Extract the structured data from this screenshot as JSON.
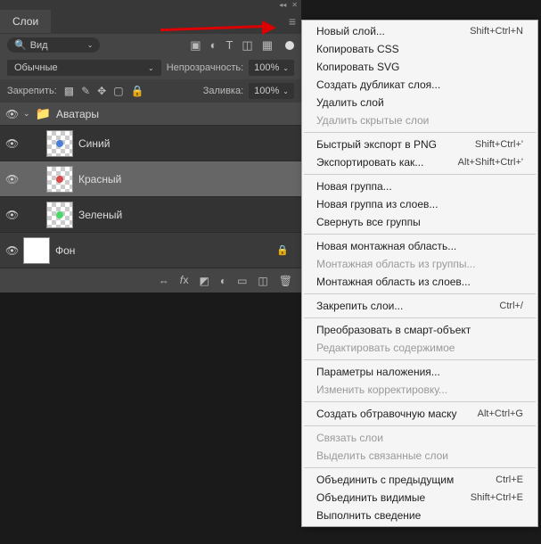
{
  "panel": {
    "tab": "Слои",
    "search": {
      "placeholder": "",
      "value": "Вид"
    },
    "blend_mode": "Обычные",
    "opacity_label": "Непрозрачность:",
    "opacity_value": "100%",
    "lock_label": "Закрепить:",
    "fill_label": "Заливка:",
    "fill_value": "100%"
  },
  "layers": {
    "folder": "Аватары",
    "items": [
      {
        "name": "Синий"
      },
      {
        "name": "Красный"
      },
      {
        "name": "Зеленый"
      },
      {
        "name": "Фон"
      }
    ]
  },
  "menu": {
    "sections": [
      [
        {
          "label": "Новый слой...",
          "shortcut": "Shift+Ctrl+N",
          "disabled": false
        },
        {
          "label": "Копировать CSS",
          "shortcut": "",
          "disabled": false
        },
        {
          "label": "Копировать SVG",
          "shortcut": "",
          "disabled": false
        },
        {
          "label": "Создать дубликат слоя...",
          "shortcut": "",
          "disabled": false
        },
        {
          "label": "Удалить слой",
          "shortcut": "",
          "disabled": false
        },
        {
          "label": "Удалить скрытые слои",
          "shortcut": "",
          "disabled": true
        }
      ],
      [
        {
          "label": "Быстрый экспорт в PNG",
          "shortcut": "Shift+Ctrl+'",
          "disabled": false
        },
        {
          "label": "Экспортировать как...",
          "shortcut": "Alt+Shift+Ctrl+'",
          "disabled": false
        }
      ],
      [
        {
          "label": "Новая группа...",
          "shortcut": "",
          "disabled": false
        },
        {
          "label": "Новая группа из слоев...",
          "shortcut": "",
          "disabled": false
        },
        {
          "label": "Свернуть все группы",
          "shortcut": "",
          "disabled": false
        }
      ],
      [
        {
          "label": "Новая монтажная область...",
          "shortcut": "",
          "disabled": false
        },
        {
          "label": "Монтажная область из группы...",
          "shortcut": "",
          "disabled": true
        },
        {
          "label": "Монтажная область из слоев...",
          "shortcut": "",
          "disabled": false
        }
      ],
      [
        {
          "label": "Закрепить слои...",
          "shortcut": "Ctrl+/",
          "disabled": false
        }
      ],
      [
        {
          "label": "Преобразовать в смарт-объект",
          "shortcut": "",
          "disabled": false
        },
        {
          "label": "Редактировать содержимое",
          "shortcut": "",
          "disabled": true
        }
      ],
      [
        {
          "label": "Параметры наложения...",
          "shortcut": "",
          "disabled": false
        },
        {
          "label": "Изменить корректировку...",
          "shortcut": "",
          "disabled": true
        }
      ],
      [
        {
          "label": "Создать обтравочную маску",
          "shortcut": "Alt+Ctrl+G",
          "disabled": false
        }
      ],
      [
        {
          "label": "Связать слои",
          "shortcut": "",
          "disabled": true
        },
        {
          "label": "Выделить связанные слои",
          "shortcut": "",
          "disabled": true
        }
      ],
      [
        {
          "label": "Объединить с предыдущим",
          "shortcut": "Ctrl+E",
          "disabled": false
        },
        {
          "label": "Объединить видимые",
          "shortcut": "Shift+Ctrl+E",
          "disabled": false
        },
        {
          "label": "Выполнить сведение",
          "shortcut": "",
          "disabled": false
        }
      ]
    ]
  }
}
